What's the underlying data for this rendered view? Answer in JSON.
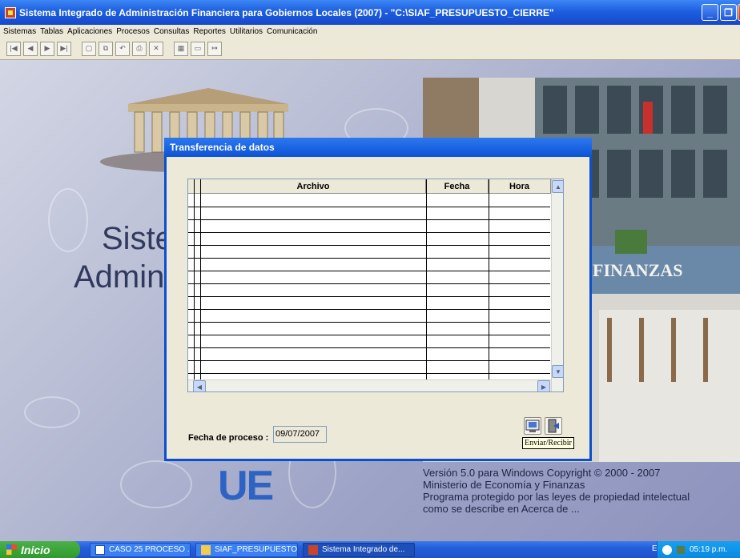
{
  "window": {
    "title": "Sistema Integrado de Administración Financiera para Gobiernos Locales (2007) - \"C:\\SIAF_PRESUPUESTO_CIERRE\"",
    "min_glyph": "_",
    "max_glyph": "❐",
    "close_glyph": "✕"
  },
  "menu": [
    "Sistemas",
    "Tablas",
    "Aplicaciones",
    "Procesos",
    "Consultas",
    "Reportes",
    "Utilitarios",
    "Comunicación"
  ],
  "toolbar": {
    "icons": [
      "first-icon",
      "prev-icon",
      "next-icon",
      "last-icon",
      "new-doc-icon",
      "copy-icon",
      "undo-icon",
      "print-icon",
      "delete-icon",
      "filter-icon",
      "save-icon",
      "exit-icon"
    ],
    "glyphs": [
      "|◀",
      "◀",
      "▶",
      "▶|",
      "▢",
      "⧉",
      "↶",
      "⎙",
      "✕",
      "▦",
      "▭",
      "↦"
    ]
  },
  "background": {
    "text_line1": "Sister",
    "text_line2": "Adminis",
    "logo_text": "UE",
    "building_sign": "FINANZAS",
    "version_lines": [
      "Versión 5.0 para Windows Copyright © 2000 - 2007",
      "Ministerio de Economía y Finanzas",
      "Programa protegido por las leyes de propiedad intelectual",
      "como se describe en Acerca de ..."
    ]
  },
  "dialog": {
    "title": "Transferencia de datos",
    "grid": {
      "columns": [
        "Archivo",
        "Fecha",
        "Hora"
      ],
      "empty_rows": 16
    },
    "fecha_label": "Fecha de proceso :",
    "fecha_value": "09/07/2007",
    "send_tooltip": "Enviar/Recibir"
  },
  "taskbar": {
    "start_label": "Inicio",
    "tasks": [
      "CASO 25 PROCESO ...",
      "SIAF_PRESUPUESTO...",
      "Sistema Integrado de..."
    ],
    "lang": "ES",
    "clock": "05:19 p.m."
  },
  "colors": {
    "titlebar": "#1d5fe0",
    "dialog_border": "#0b4fd1",
    "start_green": "#2f9a2c",
    "tooltip_bg": "#ffffe1"
  }
}
